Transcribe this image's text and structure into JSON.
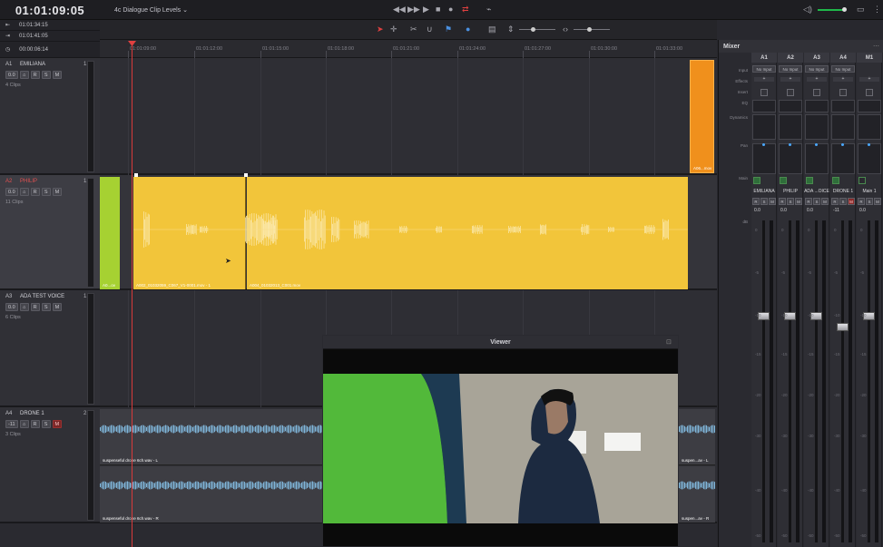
{
  "header": {
    "timecode": "01:01:09:05",
    "timeline_name": "4c Dialogue Clip Levels",
    "transport_icons": [
      "rewind-icon",
      "fast-forward-icon",
      "play-icon",
      "stop-icon",
      "record-icon",
      "loop-icon",
      "scroll-icon"
    ],
    "right_icons": [
      "speaker-icon",
      "meter-icon",
      "settings-icon"
    ]
  },
  "time_panel": [
    {
      "icon": "in-marker-icon",
      "value": "01:01:34:15"
    },
    {
      "icon": "out-marker-icon",
      "value": "01:01:41:05"
    },
    {
      "icon": "duration-icon",
      "value": "00:00:06:14"
    }
  ],
  "ruler": {
    "ticks": [
      "01:01:09:00",
      "01:01:12:00",
      "01:01:15:00",
      "01:01:18:00",
      "01:01:21:00",
      "01:01:24:00",
      "01:01:27:00",
      "01:01:30:00",
      "01:01:33:00"
    ]
  },
  "tracks": [
    {
      "id": "A1",
      "name": "EMILIANA",
      "volume": "1.0",
      "level": "0.0",
      "clips": "4 Clips",
      "muted": false,
      "clip_items": [
        {
          "name": "A06...mov",
          "color": "#f0901c"
        }
      ]
    },
    {
      "id": "A2",
      "name": "PHILIP",
      "volume": "1.0",
      "level": "0.0",
      "clips": "11 Clips",
      "muted": false,
      "clip_items": [
        {
          "name": "A0...ov",
          "color": "#a6d132"
        },
        {
          "name": "A002_01032059_C067_V1-0001.mov - 1",
          "color": "#f2c53a"
        },
        {
          "name": "A004_01032013_C001.mov",
          "color": "#f2c53a"
        }
      ]
    },
    {
      "id": "A3",
      "name": "ADA TEST VOICE",
      "volume": "1.0",
      "level": "0.0",
      "clips": "6 Clips",
      "muted": false,
      "clip_items": []
    },
    {
      "id": "A4",
      "name": "DRONE 1",
      "volume": "2.0",
      "level": "-11",
      "clips": "3 Clips",
      "muted": true,
      "clip_items": [
        {
          "name": "suspenseful drone 6ch.wav - L",
          "color": "#3d3d43"
        },
        {
          "name": "suspenseful drone 6ch.wav - R",
          "color": "#3d3d43"
        },
        {
          "name": "suspen...av - L",
          "color": "#3d3d43"
        },
        {
          "name": "suspen...av - R",
          "color": "#3d3d43"
        }
      ]
    }
  ],
  "track_buttons": {
    "lock": "⌂",
    "record": "R",
    "solo": "S",
    "mute": "M"
  },
  "viewer": {
    "title": "Viewer"
  },
  "mixer": {
    "title": "Mixer",
    "row_labels": {
      "input": "Input",
      "effects": "Effects",
      "insert": "Insert",
      "eq": "EQ",
      "dynamics": "Dynamics",
      "pan": "Pan",
      "main": "Main",
      "db": "dB"
    },
    "channels": [
      {
        "id": "A1",
        "input": "No Input",
        "name": "EMILIANA",
        "value": "0.0"
      },
      {
        "id": "A2",
        "input": "No Input",
        "name": "PHILIP",
        "value": "0.0"
      },
      {
        "id": "A3",
        "input": "No Input",
        "name": "ADA ...OICE",
        "value": "0.0"
      },
      {
        "id": "A4",
        "input": "No Input",
        "name": "DRONE 1",
        "value": "-11"
      },
      {
        "id": "M1",
        "input": "",
        "name": "Main 1",
        "value": "0.0"
      }
    ],
    "scale": [
      "0",
      "-5",
      "-10",
      "-15",
      "-20",
      "-30",
      "-40",
      "-50"
    ]
  },
  "colors": {
    "accent_red": "#e04040",
    "a1_clip": "#f0901c",
    "a2_clip": "#f2c53a",
    "a2_clip_green": "#a6d132",
    "wave_blue": "#7fb5d9"
  }
}
